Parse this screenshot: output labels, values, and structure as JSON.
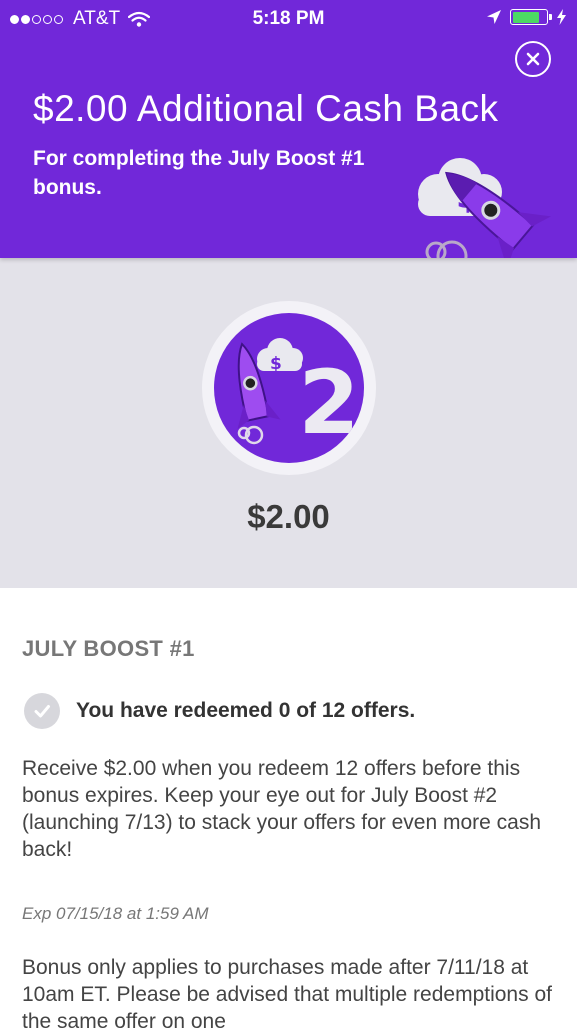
{
  "status_bar": {
    "carrier": "AT&T",
    "time": "5:18 PM",
    "signal_bars_filled": 2,
    "signal_bars_total": 5,
    "battery_level": 0.8,
    "battery_color": "#4cd964",
    "icons": [
      "wifi-icon",
      "location-arrow-icon",
      "battery-icon",
      "charging-bolt-icon"
    ]
  },
  "banner": {
    "title": "$2.00 Additional Cash Back",
    "subtitle": "For completing the July Boost #1 bonus.",
    "background": "#7128d9",
    "close_icon": "close-circle-icon",
    "illustration": "rocket-cloud-dollar"
  },
  "hero": {
    "badge_number": "2",
    "badge_dollar": "$",
    "amount": "$2.00",
    "background": "#e3e2e9"
  },
  "details": {
    "section_title": "JULY BOOST #1",
    "progress_text": "You have redeemed 0 of 12 offers.",
    "description": "Receive $2.00 when you redeem 12 offers before this bonus expires. Keep your eye out for July Boost #2 (launching 7/13) to stack your offers for even more cash back!",
    "expiry": "Exp 07/15/18 at 1:59 AM",
    "disclaimer": "Bonus only applies to purchases made after 7/11/18 at 10am ET. Please be advised that multiple redemptions of the same offer on one"
  }
}
